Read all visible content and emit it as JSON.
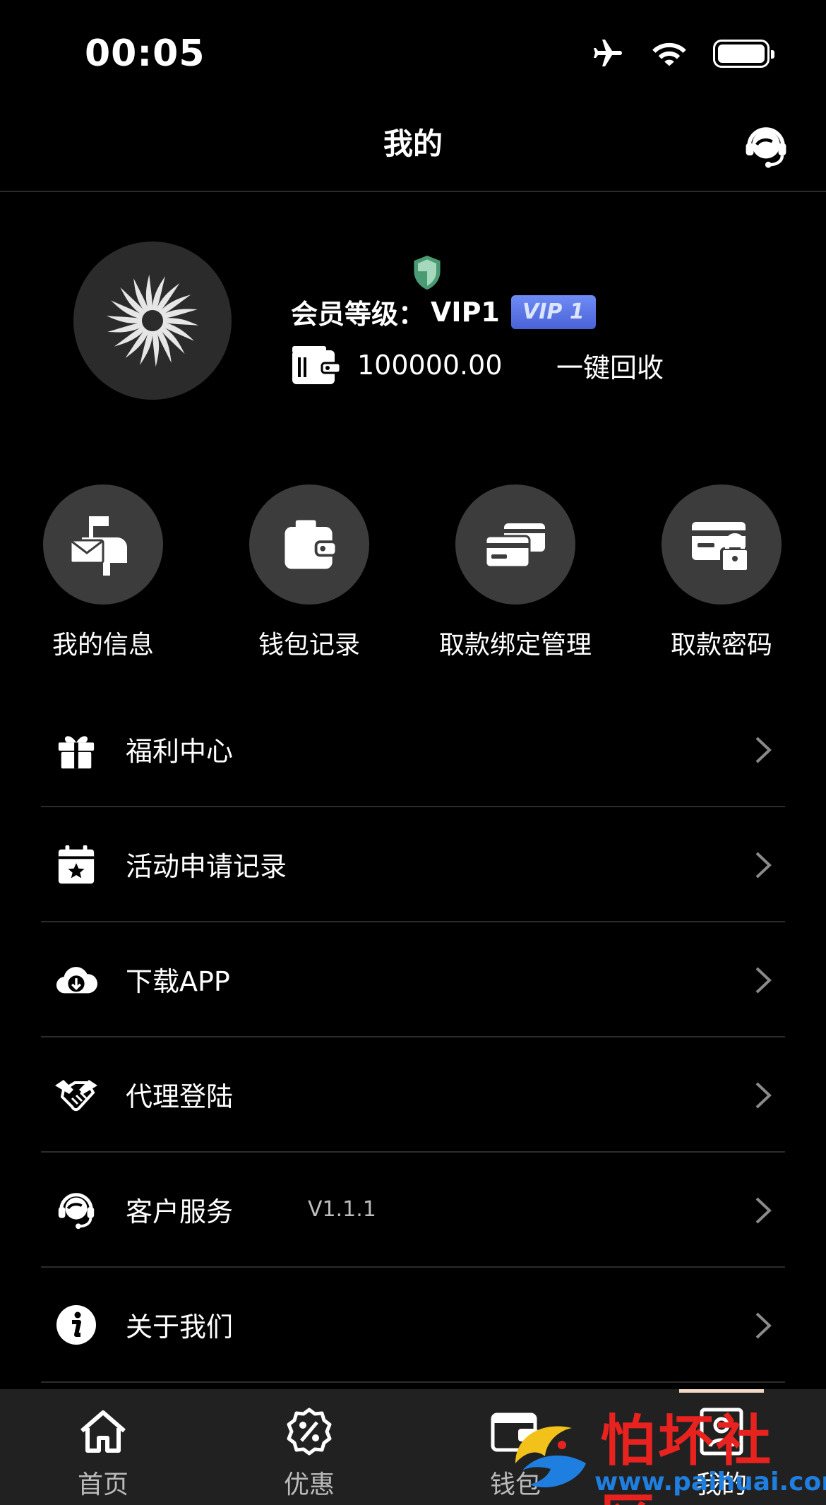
{
  "status_bar": {
    "time": "00:05",
    "icons": [
      "airplane-icon",
      "wifi-icon",
      "battery-icon"
    ]
  },
  "header": {
    "title": "我的",
    "support_icon": "headset-icon"
  },
  "profile": {
    "vip_label": "会员等级：",
    "vip_level": "VIP1",
    "vip_badge": "VIP 1",
    "balance": "100000.00",
    "recycle_label": "一键回收"
  },
  "quick_actions": [
    {
      "label": "我的信息",
      "icon": "mailbox-icon"
    },
    {
      "label": "钱包记录",
      "icon": "wallet-icon"
    },
    {
      "label": "取款绑定管理",
      "icon": "cards-icon"
    },
    {
      "label": "取款密码",
      "icon": "card-lock-icon"
    }
  ],
  "menu": [
    {
      "label": "福利中心",
      "icon": "gift-icon",
      "extra": ""
    },
    {
      "label": "活动申请记录",
      "icon": "calendar-star-icon",
      "extra": ""
    },
    {
      "label": "下载APP",
      "icon": "cloud-download-icon",
      "extra": ""
    },
    {
      "label": "代理登陆",
      "icon": "handshake-icon",
      "extra": ""
    },
    {
      "label": "客户服务",
      "icon": "headset-icon",
      "extra": "V1.1.1"
    },
    {
      "label": "关于我们",
      "icon": "info-icon",
      "extra": ""
    }
  ],
  "tabbar": [
    {
      "label": "首页",
      "icon": "home-icon",
      "active": false
    },
    {
      "label": "优惠",
      "icon": "discount-icon",
      "active": false
    },
    {
      "label": "钱包",
      "icon": "wallet-tab-icon",
      "active": false
    },
    {
      "label": "我的",
      "icon": "profile-icon",
      "active": true
    }
  ],
  "watermark": {
    "text": "怕坏社区",
    "url": "www.paihuai.com"
  },
  "colors": {
    "background": "#000000",
    "tabbar": "#212121",
    "vip_badge": "#5a74e6",
    "shield": "#4a9a73",
    "watermark_red": "#e8231f",
    "watermark_blue": "#1f7fe0"
  }
}
